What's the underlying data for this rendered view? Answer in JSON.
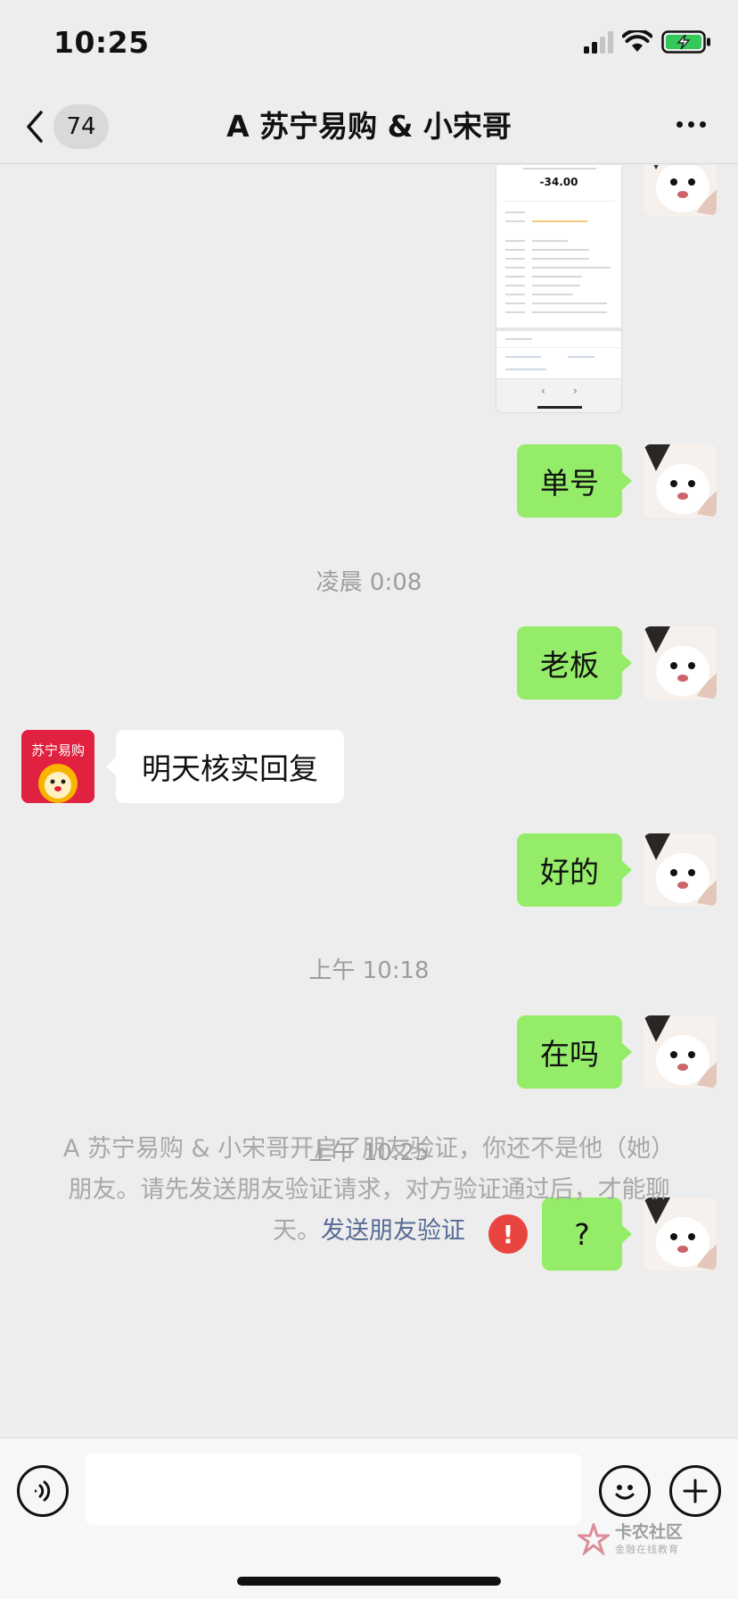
{
  "status_bar": {
    "time": "10:25",
    "battery_color": "#34c759"
  },
  "nav": {
    "unread_count": "74",
    "title": "A 苏宁易购 & 小宋哥"
  },
  "shared_image": {
    "amount": "-34.00"
  },
  "messages": [
    {
      "from": "self",
      "text": "单号"
    },
    {
      "from": "self",
      "text": "老板"
    },
    {
      "from": "shop",
      "text": "明天核实回复"
    },
    {
      "from": "self",
      "text": "好的"
    },
    {
      "from": "self",
      "text": "在吗"
    },
    {
      "from": "self",
      "text": "?",
      "failed": true
    }
  ],
  "timestamps": [
    "凌晨 0:08",
    "上午 10:18",
    "上午 10:25"
  ],
  "shop_avatar": {
    "logo_text": "苏宁易购",
    "brand_color": "#e0213f"
  },
  "system_notice": {
    "text": "A 苏宁易购 & 小宋哥开启了朋友验证，你还不是他（她）朋友。请先发送朋友验证请求，对方验证通过后，才能聊天。",
    "link": "发送朋友验证"
  },
  "input_bar": {
    "voice_icon": "voice-icon",
    "emoji_icon": "emoji-icon",
    "plus_icon": "plus-icon",
    "placeholder": ""
  },
  "watermark": {
    "title": "卡农社区",
    "subtitle": "金融在线教育"
  },
  "colors": {
    "outgoing_bubble": "#95ec69",
    "link": "#576b95",
    "error": "#e94540"
  }
}
